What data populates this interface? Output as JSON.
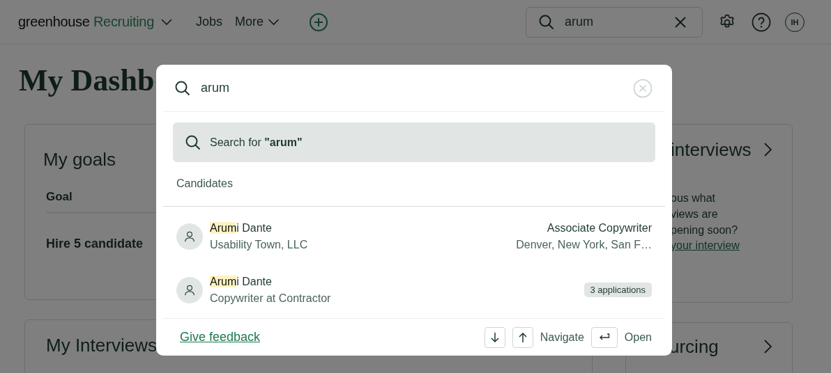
{
  "header": {
    "logo_word": "greenhouse",
    "product": "Recruiting",
    "nav": [
      "Jobs",
      "More"
    ],
    "search": {
      "value": "arum"
    },
    "avatar": "IH"
  },
  "page": {
    "title": "My Dashb",
    "goals_card": {
      "title": "My goals",
      "column": "Goal",
      "goal": "Hire 5 candidate"
    },
    "interviews_card": {
      "title": "My Interviews"
    },
    "side_card": {
      "title": "interviews",
      "lines": [
        "ous what",
        "views are",
        "pening soon?"
      ],
      "link": "your interview"
    },
    "sourcing_card": {
      "title": "urcing"
    }
  },
  "search_dialog": {
    "query": "arum",
    "search_for": "Search for **\"arum\"**",
    "section": "Candidates",
    "results": [
      {
        "name_match": "Arum",
        "name_rest": "i Dante",
        "subtitle": "Usability Town, LLC",
        "kind": "job",
        "job": "Associate Copywriter",
        "location": "Denver, New York, San F…"
      },
      {
        "name_match": "Arum",
        "name_rest": "i Dante",
        "subtitle": "Copywriter at Contractor",
        "kind": "badge",
        "badge": "3 applications"
      }
    ],
    "feedback": "Give feedback",
    "navigate": "Navigate",
    "open": "Open"
  }
}
